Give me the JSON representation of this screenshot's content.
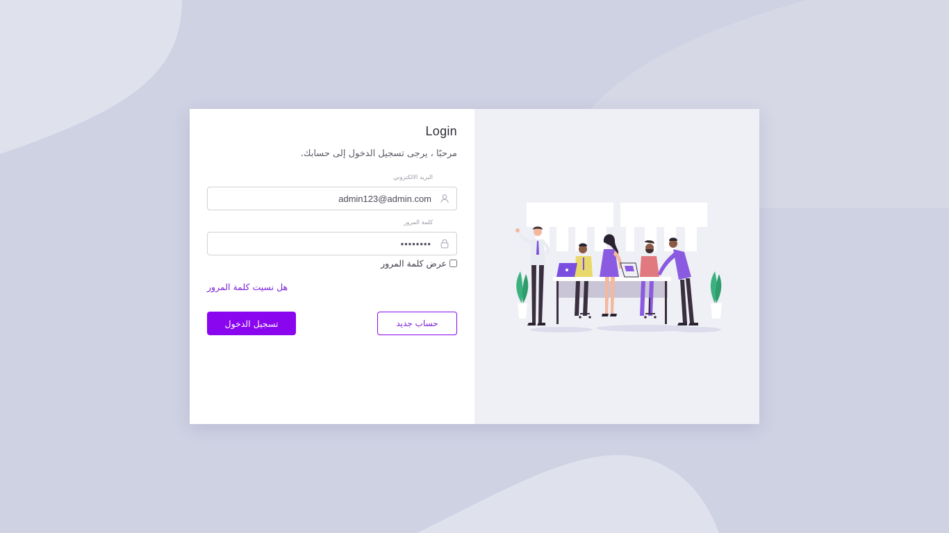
{
  "login": {
    "title": "Login",
    "subtitle": "مرحبًا ، يرجى تسجيل الدخول إلى حسابك.",
    "email_label": "البريد الالكتروني",
    "email_value": "admin123@admin.com",
    "password_label": "كلمة المرور",
    "password_value": "12345678",
    "show_password_label": "عرض كلمة المرور",
    "forgot_password_link": "هل نسيت كلمة المرور",
    "login_button": "تسجيل الدخول",
    "register_button": "حساب جديد"
  },
  "icons": {
    "email": "user-icon",
    "password": "lock-icon"
  },
  "colors": {
    "accent": "#8a06ef",
    "background": "#cfd2e3",
    "card": "#ffffff",
    "illustration_panel": "#eff0f5"
  }
}
